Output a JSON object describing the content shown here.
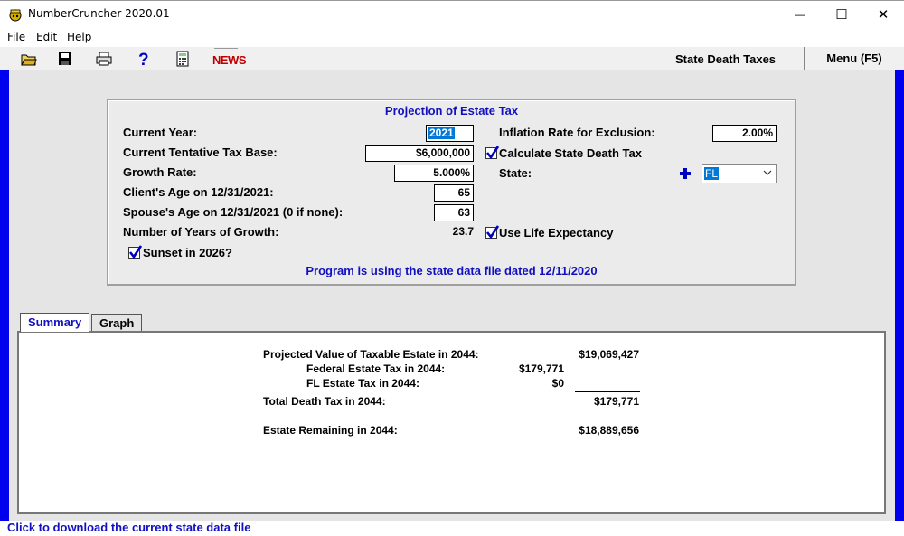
{
  "window": {
    "title": "NumberCruncher 2020.01",
    "minimize_glyph": "—",
    "maximize_glyph": "☐",
    "close_glyph": "✕"
  },
  "menu": [
    "File",
    "Edit",
    "Help"
  ],
  "toolbar": {
    "icons": [
      "open-folder-icon",
      "save-disk-icon",
      "print-icon",
      "help-question-icon",
      "calculator-icon",
      "news-icon"
    ],
    "news_label": "NEWS",
    "section_title": "State Death Taxes",
    "menu_label": "Menu (F5)"
  },
  "projection": {
    "title": "Projection of Estate Tax",
    "current_year_label": "Current Year:",
    "current_year_value": "2021",
    "tentative_base_label": "Current Tentative Tax Base:",
    "tentative_base_value": "$6,000,000",
    "growth_rate_label": "Growth Rate:",
    "growth_rate_value": "5.000%",
    "client_age_label": "Client's Age on 12/31/2021:",
    "client_age_value": "65",
    "spouse_age_label": "Spouse's Age on 12/31/2021 (0 if none):",
    "spouse_age_value": "63",
    "years_growth_label": "Number of Years of Growth:",
    "years_growth_value": "23.7",
    "sunset_label": "Sunset in 2026?",
    "inflation_label": "Inflation Rate for Exclusion:",
    "inflation_value": "2.00%",
    "calc_state_label": "Calculate State Death Tax",
    "state_label": "State:",
    "state_value": "FL",
    "life_exp_label": "Use Life Expectancy",
    "data_file_note": "Program is using the state data file dated 12/11/2020"
  },
  "tabs": [
    "Summary",
    "Graph"
  ],
  "summary": {
    "projected_label": "Projected Value of Taxable Estate in 2044:",
    "projected_value": "$19,069,427",
    "federal_label": "Federal Estate Tax in 2044:",
    "federal_value": "$179,771",
    "state_tax_label": "FL Estate Tax in 2044:",
    "state_tax_value": "$0",
    "total_label": "Total Death Tax in 2044:",
    "total_value": "$179,771",
    "remaining_label": "Estate Remaining in 2044:",
    "remaining_value": "$18,889,656"
  },
  "status": {
    "link_text": "Click to download the current state data file"
  },
  "colors": {
    "accent_blue": "#0000ee",
    "link_blue": "#1010c0",
    "selection": "#0078d7"
  }
}
